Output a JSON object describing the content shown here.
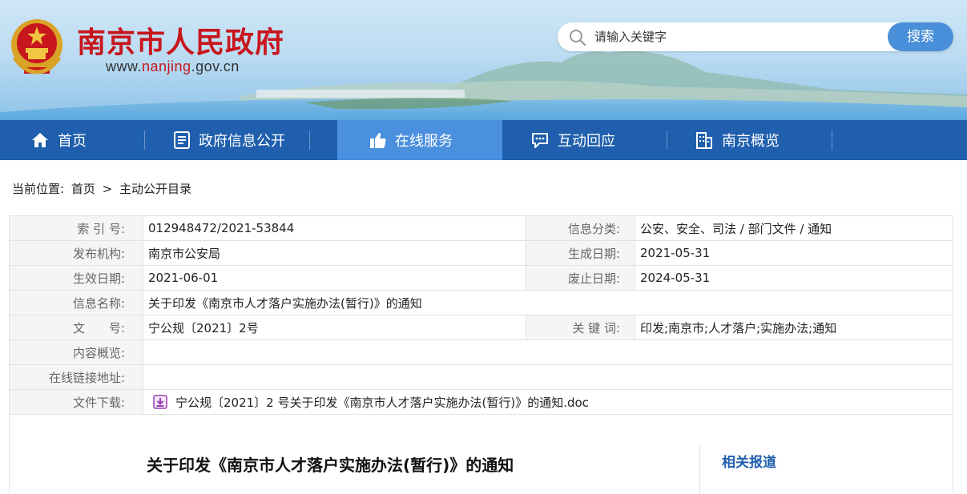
{
  "header": {
    "site_name": "南京市人民政府",
    "url_prefix": "www.",
    "url_highlight": "nanjing",
    "url_suffix": ".gov.cn",
    "emblem_icon": "national-emblem-icon",
    "search": {
      "placeholder": "请输入关键字",
      "value": "",
      "button_label": "搜索"
    }
  },
  "nav": {
    "items": [
      {
        "label": "首页",
        "icon": "home-icon"
      },
      {
        "label": "政府信息公开",
        "icon": "document-icon"
      },
      {
        "label": "在线服务",
        "icon": "thumbs-up-icon",
        "active": true
      },
      {
        "label": "互动回应",
        "icon": "chat-icon"
      },
      {
        "label": "南京概览",
        "icon": "building-icon"
      }
    ]
  },
  "breadcrumb": {
    "prefix": "当前位置:",
    "items": [
      "首页",
      ">",
      "主动公开目录"
    ]
  },
  "info": {
    "index_no_label": "索 引 号:",
    "index_no": "012948472/2021-53844",
    "category_label": "信息分类:",
    "category": "公安、安全、司法 / 部门文件 / 通知",
    "publisher_label": "发布机构:",
    "publisher": "南京市公安局",
    "created_label": "生成日期:",
    "created": "2021-05-31",
    "effective_label": "生效日期:",
    "effective": "2021-06-01",
    "expiry_label": "废止日期:",
    "expiry": "2024-05-31",
    "name_label": "信息名称:",
    "name": "关于印发《南京市人才落户实施办法(暂行)》的通知",
    "doc_no_label": "文　　号:",
    "doc_no": "宁公规〔2021〕2号",
    "keywords_label": "关 键 词:",
    "keywords": "印发;南京市;人才落户;实施办法;通知",
    "summary_label": "内容概览:",
    "summary": "",
    "link_label": "在线链接地址:",
    "link": "",
    "download_label": "文件下载:",
    "download_file": "宁公规〔2021〕2 号关于印发《南京市人才落户实施办法(暂行)》的通知.doc"
  },
  "document": {
    "title": "关于印发《南京市人才落户实施办法(暂行)》的通知",
    "related_label": "相关报道"
  },
  "colors": {
    "brand_red": "#c8161d",
    "nav_blue": "#1f5fad",
    "nav_active": "#4a90de",
    "search_button": "#4a8fd9"
  }
}
